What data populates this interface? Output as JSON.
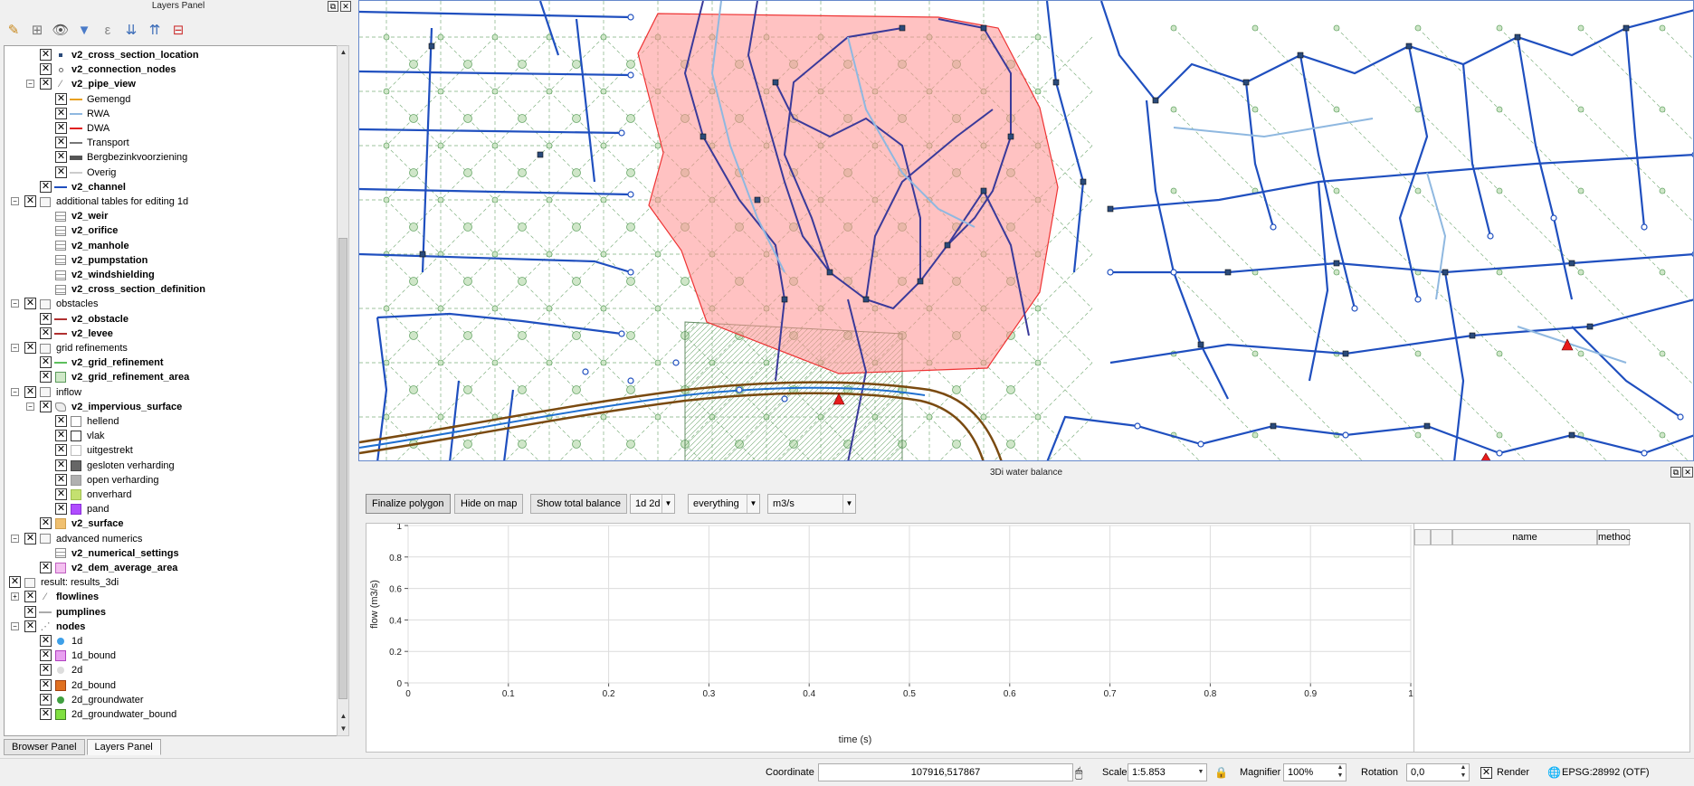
{
  "layers_panel": {
    "title": "Layers Panel",
    "tree": [
      {
        "label": "v2_cross_section_location",
        "bold": true
      },
      {
        "label": "v2_connection_nodes",
        "bold": true
      },
      {
        "label": "v2_pipe_view",
        "bold": true
      },
      {
        "label": "Gemengd",
        "bold": false
      },
      {
        "label": "RWA",
        "bold": false
      },
      {
        "label": "DWA",
        "bold": false
      },
      {
        "label": "Transport",
        "bold": false
      },
      {
        "label": "Bergbezinkvoorziening",
        "bold": false
      },
      {
        "label": "Overig",
        "bold": false
      },
      {
        "label": "v2_channel",
        "bold": true
      },
      {
        "label": "additional tables for editing 1d",
        "bold": false
      },
      {
        "label": "v2_weir",
        "bold": true
      },
      {
        "label": "v2_orifice",
        "bold": true
      },
      {
        "label": "v2_manhole",
        "bold": true
      },
      {
        "label": "v2_pumpstation",
        "bold": true
      },
      {
        "label": "v2_windshielding",
        "bold": true
      },
      {
        "label": "v2_cross_section_definition",
        "bold": true
      },
      {
        "label": "obstacles",
        "bold": false
      },
      {
        "label": "v2_obstacle",
        "bold": true
      },
      {
        "label": "v2_levee",
        "bold": true
      },
      {
        "label": "grid refinements",
        "bold": false
      },
      {
        "label": "v2_grid_refinement",
        "bold": true
      },
      {
        "label": "v2_grid_refinement_area",
        "bold": true
      },
      {
        "label": "inflow",
        "bold": false
      },
      {
        "label": "v2_impervious_surface",
        "bold": true
      },
      {
        "label": "hellend",
        "bold": false
      },
      {
        "label": "vlak",
        "bold": false
      },
      {
        "label": "uitgestrekt",
        "bold": false
      },
      {
        "label": "gesloten verharding",
        "bold": false
      },
      {
        "label": "open verharding",
        "bold": false
      },
      {
        "label": "onverhard",
        "bold": false
      },
      {
        "label": "pand",
        "bold": false
      },
      {
        "label": "v2_surface",
        "bold": true
      },
      {
        "label": "advanced numerics",
        "bold": false
      },
      {
        "label": "v2_numerical_settings",
        "bold": true
      },
      {
        "label": "v2_dem_average_area",
        "bold": true
      },
      {
        "label": "result: results_3di",
        "bold": false
      },
      {
        "label": "flowlines",
        "bold": true
      },
      {
        "label": "pumplines",
        "bold": true
      },
      {
        "label": "nodes",
        "bold": true
      },
      {
        "label": "1d",
        "bold": false
      },
      {
        "label": "1d_bound",
        "bold": false
      },
      {
        "label": "2d",
        "bold": false
      },
      {
        "label": "2d_bound",
        "bold": false
      },
      {
        "label": "2d_groundwater",
        "bold": false
      },
      {
        "label": "2d_groundwater_bound",
        "bold": false
      }
    ],
    "tabs": [
      "Browser Panel",
      "Layers Panel"
    ]
  },
  "water_balance": {
    "title": "3Di water balance",
    "buttons": {
      "finalize": "Finalize polygon",
      "hide": "Hide on map",
      "show_total": "Show total balance"
    },
    "selects": {
      "dims": "1d 2d",
      "filter": "everything",
      "unit": "m3/s"
    },
    "table_headers": [
      "",
      "",
      "name",
      "methoc"
    ]
  },
  "chart_data": {
    "type": "line",
    "xlabel": "time (s)",
    "ylabel": "flow (m3/s)",
    "xlim": [
      0,
      1
    ],
    "ylim": [
      0,
      1
    ],
    "x_ticks": [
      "0",
      "0.1",
      "0.2",
      "0.3",
      "0.4",
      "0.5",
      "0.6",
      "0.7",
      "0.8",
      "0.9",
      "1"
    ],
    "y_ticks": [
      "0",
      "0.2",
      "0.4",
      "0.6",
      "0.8",
      "1"
    ],
    "grid": true,
    "series": []
  },
  "status_bar": {
    "coordinate_label": "Coordinate",
    "coordinate_value": "107916,517867",
    "scale_label": "Scale",
    "scale_value": "1:5.853",
    "magnifier_label": "Magnifier",
    "magnifier_value": "100%",
    "rotation_label": "Rotation",
    "rotation_value": "0,0",
    "render_label": "Render",
    "crs": "EPSG:28992 (OTF)"
  },
  "colors": {
    "pipe_blue": "#1f4fbf",
    "polygon_fill": "#ff9a9a",
    "grid_green": "#5fa05f"
  }
}
